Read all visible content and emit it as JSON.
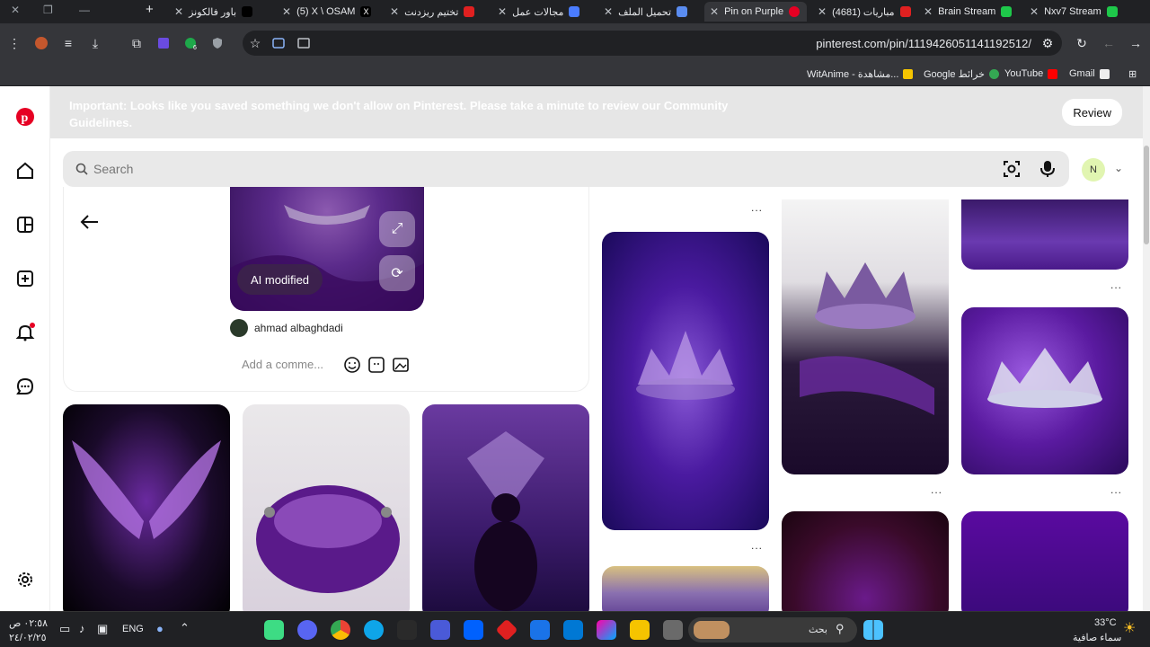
{
  "browser": {
    "tabs": [
      {
        "title": "Nxv7 Stream",
        "color": "#1ec84a",
        "active": false
      },
      {
        "title": "Brain Stream",
        "color": "#1ec84a",
        "active": false
      },
      {
        "title": "(4681) مباريات",
        "color": "#e02020",
        "active": false
      },
      {
        "title": "Pin on Purple",
        "color": "#e60023",
        "active": true
      },
      {
        "title": "تحميل الملف",
        "color": "#5a8cf0",
        "active": false
      },
      {
        "title": "مجالات عمل",
        "color": "#4a7cff",
        "active": false
      },
      {
        "title": "تختيم ريزدنت",
        "color": "#e02020",
        "active": false
      },
      {
        "title": "(5) X \\ OSAM",
        "color": "#000000",
        "active": false
      },
      {
        "title": "باور فالكونز",
        "color": "#000000",
        "active": false
      }
    ],
    "new_tab_symbol": "+",
    "url": "pinterest.com/pin/1119426051141192512/",
    "bookmarks": [
      {
        "label": "Gmail",
        "color": "#eeeeee"
      },
      {
        "label": "YouTube",
        "color": "#ff0000"
      },
      {
        "label": "Google خرائط",
        "color": "#34a853"
      },
      {
        "label": "WitAnime - مشاهدة...",
        "color": "#f5c400"
      }
    ]
  },
  "pinterest": {
    "banner_text": "Important: Looks like you saved something we don't allow on Pinterest. Please take a minute to review our Community Guidelines.",
    "review_label": "Review",
    "search_placeholder": "Search",
    "avatar_initial": "N",
    "pin": {
      "badge": "AI modified",
      "author": "ahmad albaghdadi",
      "comment_placeholder": "Add a comme..."
    },
    "more_glyph": "..."
  },
  "taskbar": {
    "time": "٠٢:٥٨ ص",
    "date": "٢٤/٠٢/٢٥",
    "lang": "ENG",
    "search_label": "بحث",
    "temperature": "33°C",
    "weather": "سماء صافية"
  },
  "colors": {
    "pinterest_red": "#e60023",
    "banner_bg": "#e6e6e6"
  }
}
